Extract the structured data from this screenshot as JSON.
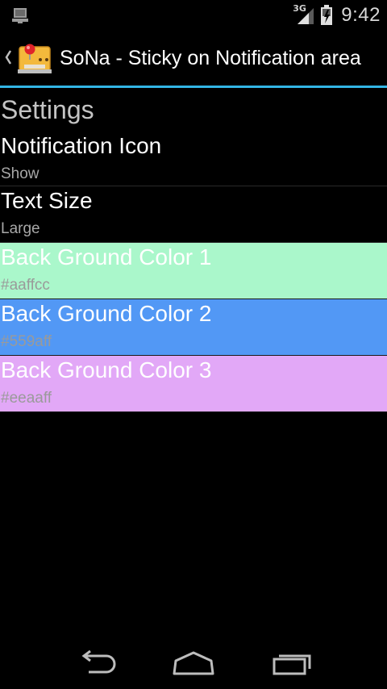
{
  "status_bar": {
    "network": "3G",
    "time": "9:42"
  },
  "action_bar": {
    "title": "SoNa - Sticky on Notification area"
  },
  "settings": {
    "category": "Settings",
    "items": [
      {
        "title": "Notification Icon",
        "summary": "Show"
      },
      {
        "title": "Text Size",
        "summary": "Large"
      },
      {
        "title": "Back Ground Color 1",
        "summary": "#aaffcc",
        "color": "#aaffcc"
      },
      {
        "title": "Back Ground Color 2",
        "summary": "#559aff",
        "color": "#559aff"
      },
      {
        "title": "Back Ground Color 3",
        "summary": "#eeaaff",
        "color": "#e2a8f7"
      }
    ]
  },
  "colors": {
    "accent": "#33b5e5",
    "background": "#000000"
  },
  "icons": {
    "status_left": "usb-debug-icon",
    "signal": "signal-icon",
    "battery": "battery-icon",
    "up": "up-caret-icon",
    "app": "app-icon",
    "back": "back-icon",
    "home": "home-icon",
    "recents": "recents-icon"
  }
}
